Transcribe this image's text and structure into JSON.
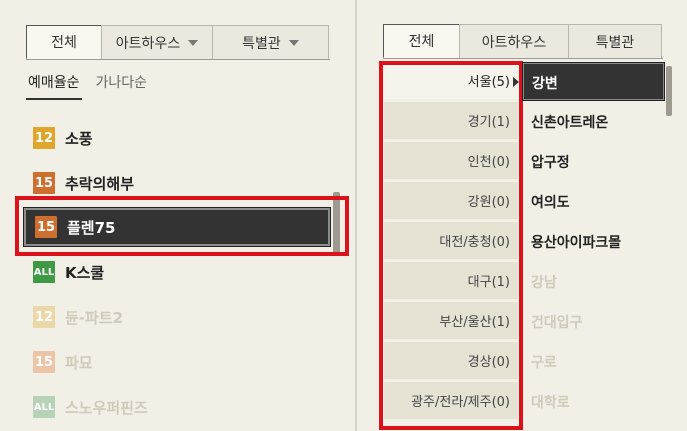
{
  "left": {
    "tabs": [
      {
        "label": "전체",
        "active": true
      },
      {
        "label": "아트하우스",
        "dropdown": true
      },
      {
        "label": "특별관",
        "dropdown": true
      }
    ],
    "sort": [
      "예매율순",
      "가나다순"
    ],
    "movies": [
      {
        "rating": "12",
        "title": "소풍"
      },
      {
        "rating": "15",
        "title": "추락의해부"
      },
      {
        "rating": "15",
        "title": "플렌75",
        "selected": true
      },
      {
        "rating": "ALL",
        "title": "K스쿨"
      },
      {
        "rating": "12",
        "title": "듄-파트2",
        "disabled": true
      },
      {
        "rating": "15",
        "title": "파묘",
        "disabled": true
      },
      {
        "rating": "ALL",
        "title": "스노우퍼핀즈",
        "disabled": true
      }
    ]
  },
  "right": {
    "tabs": [
      {
        "label": "전체",
        "active": true
      },
      {
        "label": "아트하우스"
      },
      {
        "label": "특별관"
      }
    ],
    "regions": [
      "서울(5)",
      "경기(1)",
      "인천(0)",
      "강원(0)",
      "대전/충청(0)",
      "대구(1)",
      "부산/울산(1)",
      "경상(0)",
      "광주/전라/제주(0)"
    ],
    "theaters": [
      {
        "name": "강변",
        "selected": true
      },
      {
        "name": "신촌아트레온"
      },
      {
        "name": "압구정"
      },
      {
        "name": "여의도"
      },
      {
        "name": "용산아이파크몰"
      },
      {
        "name": "강남",
        "disabled": true
      },
      {
        "name": "건대입구",
        "disabled": true
      },
      {
        "name": "구로",
        "disabled": true
      },
      {
        "name": "대학로",
        "disabled": true
      }
    ]
  },
  "colors": {
    "highlight": "#d9121b",
    "selected_bg": "#333333",
    "rating_12": "#e0a52b",
    "rating_15": "#cf6f2f",
    "rating_all": "#3f9a45"
  }
}
